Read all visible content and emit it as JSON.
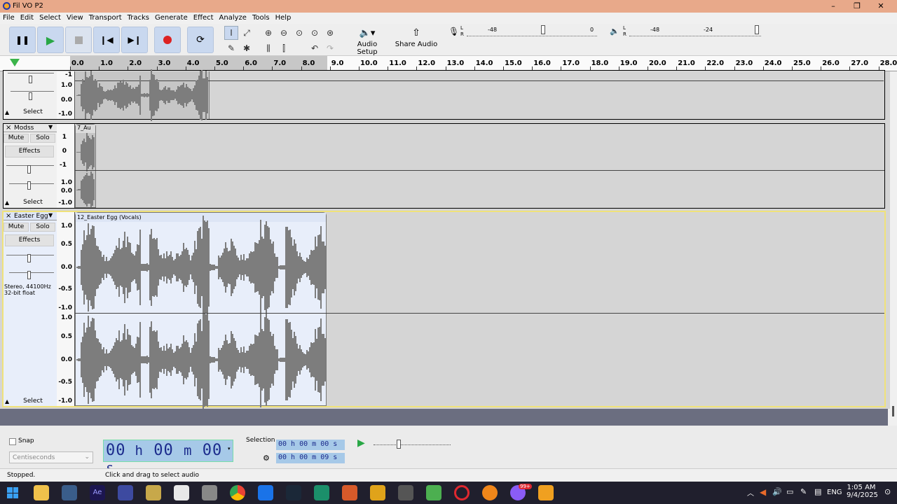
{
  "window": {
    "title": "Fil VO P2",
    "minimize": "–",
    "maximize": "❐",
    "close": "✕"
  },
  "menu": [
    "File",
    "Edit",
    "Select",
    "View",
    "Transport",
    "Tracks",
    "Generate",
    "Effect",
    "Analyze",
    "Tools",
    "Help"
  ],
  "toolbar": {
    "audio_setup": "Audio Setup",
    "share_audio": "Share Audio",
    "rec_meter_ticks": [
      "-48",
      "-24",
      "0"
    ],
    "play_meter_ticks": [
      "-48",
      "-24"
    ],
    "meter_lr": [
      "L",
      "R"
    ]
  },
  "ruler": {
    "ticks": [
      "0.0",
      "1.0",
      "2.0",
      "3.0",
      "4.0",
      "5.0",
      "6.0",
      "7.0",
      "8.0",
      "9.0",
      "10.0",
      "11.0",
      "12.0",
      "13.0",
      "14.0",
      "15.0",
      "16.0",
      "17.0",
      "18.0",
      "19.0",
      "20.0",
      "21.0",
      "22.0",
      "23.0",
      "24.0",
      "25.0",
      "26.0",
      "27.0",
      "28.0"
    ]
  },
  "tracks": [
    {
      "name": "",
      "select": "Select",
      "scale_top": [
        "-1"
      ],
      "scale_bottom": [
        "1.0",
        "0.0",
        "-1.0"
      ]
    },
    {
      "name": "Modss",
      "mute": "Mute",
      "solo": "Solo",
      "effects": "Effects",
      "select": "Select",
      "clip": "7_Au",
      "scale_top": [
        "1",
        "0",
        "-1"
      ],
      "scale_bottom": [
        "1.0",
        "0.0",
        "-1.0"
      ]
    },
    {
      "name": "Easter Egg",
      "mute": "Mute",
      "solo": "Solo",
      "effects": "Effects",
      "select": "Select",
      "clip": "12_Easter Egg (Vocals)",
      "info1": "Stereo, 44100Hz",
      "info2": "32-bit float",
      "scale_top": [
        "1.0",
        "0.5",
        "0.0",
        "-0.5",
        "-1.0"
      ],
      "scale_bottom": [
        "1.0",
        "0.5",
        "0.0",
        "-0.5",
        "-1.0"
      ]
    }
  ],
  "bottom": {
    "snap": "Snap",
    "snap_unit": "Centiseconds",
    "time": {
      "h": "00",
      "hl": "h",
      "m": "00",
      "ml": "m",
      "s": "00",
      "sl": "s"
    },
    "selection_label": "Selection",
    "sel_start": "00 h 00 m 00 s",
    "sel_end": "00 h 00 m 09 s",
    "status": "Stopped.",
    "hint": "Click and drag to select audio"
  },
  "taskbar": {
    "lang": "ENG",
    "time": "1:05 AM",
    "date": "9/4/2025",
    "badge": "99+"
  },
  "colors": {
    "titlebar": "#e8a98a",
    "button": "#c9d8ef",
    "selected_track": "#e8eefa",
    "waveform": "#7d7d7d",
    "taskbar": "#201f2d"
  }
}
